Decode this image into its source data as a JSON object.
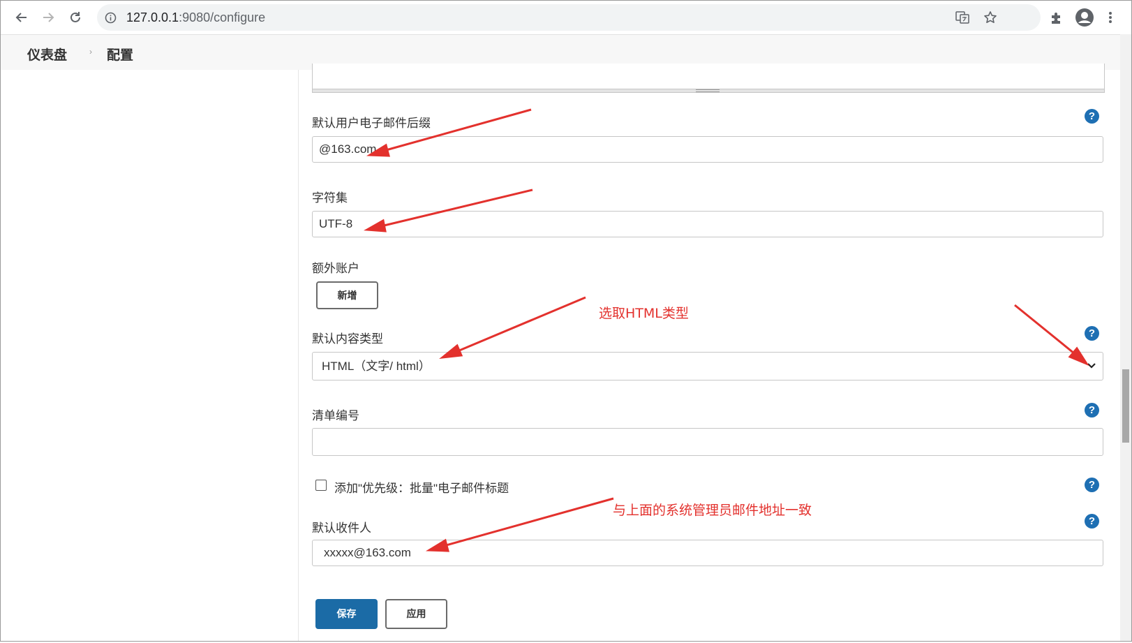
{
  "browser": {
    "url_host": "127.0.0.1",
    "url_path": ":9080/configure"
  },
  "breadcrumb": {
    "items": [
      "仪表盘",
      "配置"
    ]
  },
  "form": {
    "email_suffix_label": "默认用户电子邮件后缀",
    "email_suffix_value": "@163.com",
    "charset_label": "字符集",
    "charset_value": "UTF-8",
    "extra_accounts_label": "额外账户",
    "add_button": "新增",
    "content_type_label": "默认内容类型",
    "content_type_value": "HTML（文字/ html）",
    "list_id_label": "清单编号",
    "list_id_value": "",
    "precedence_checkbox_label": "添加\"优先级：批量\"电子邮件标题",
    "precedence_checked": false,
    "recipients_label": "默认收件人",
    "recipients_value": "xxxxx@163.com",
    "help_glyph": "?"
  },
  "actions": {
    "save": "保存",
    "apply": "应用"
  },
  "annotations": {
    "select_html": "选取HTML类型",
    "same_as_admin": "与上面的系统管理员邮件地址一致",
    "color": "#e3312d"
  },
  "colors": {
    "primary": "#1b6ba6",
    "help": "#1e6fb3"
  }
}
